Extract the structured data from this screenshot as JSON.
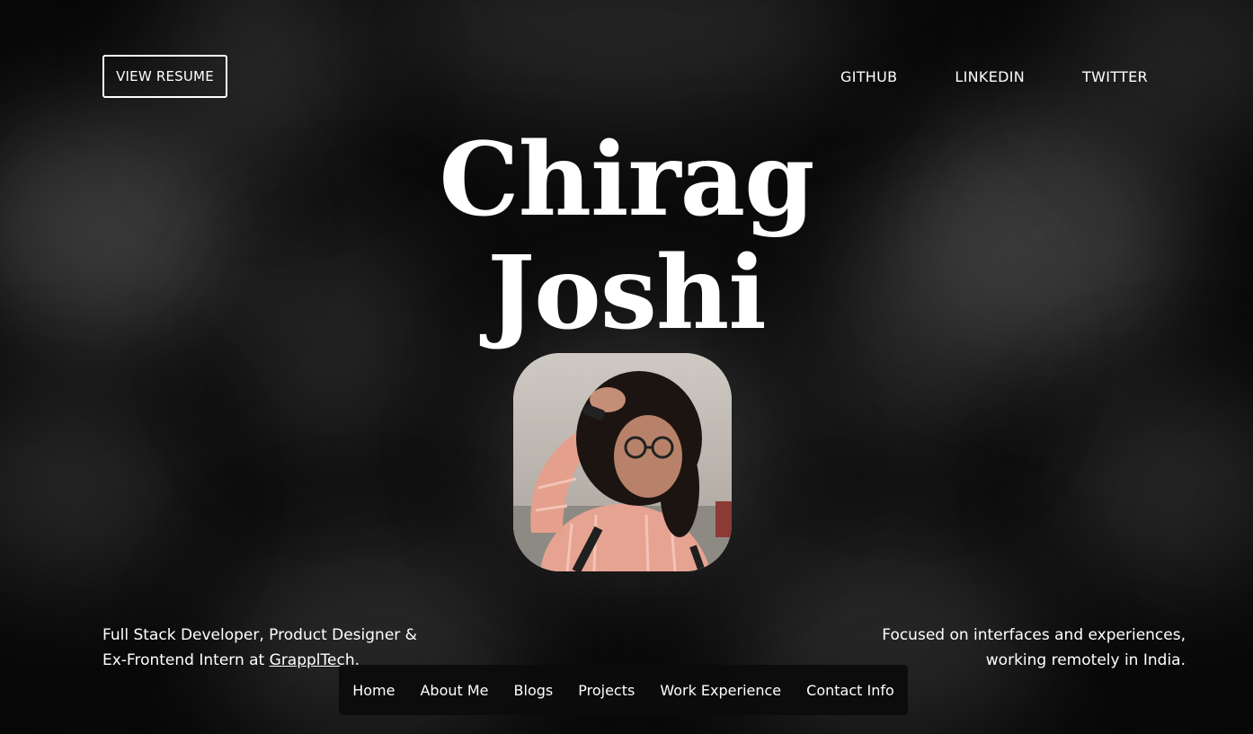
{
  "header": {
    "resume_label": "VIEW RESUME",
    "social_links": [
      "GITHUB",
      "LINKEDIN",
      "TWITTER"
    ]
  },
  "hero": {
    "first_name": "Chirag",
    "last_name": "Joshi"
  },
  "bio_left": {
    "prefix": "Full Stack Developer, Product Designer & Ex-Frontend Intern at ",
    "company_link": "GrapplTech."
  },
  "bio_right": {
    "text": "Focused on interfaces and experiences, working remotely in India."
  },
  "bottom_nav": {
    "items": [
      "Home",
      "About Me",
      "Blogs",
      "Projects",
      "Work Experience",
      "Contact Info"
    ]
  },
  "colors": {
    "background": "#0b0b0b",
    "text": "#ffffff",
    "nav_bar": "#0c0c0c"
  }
}
